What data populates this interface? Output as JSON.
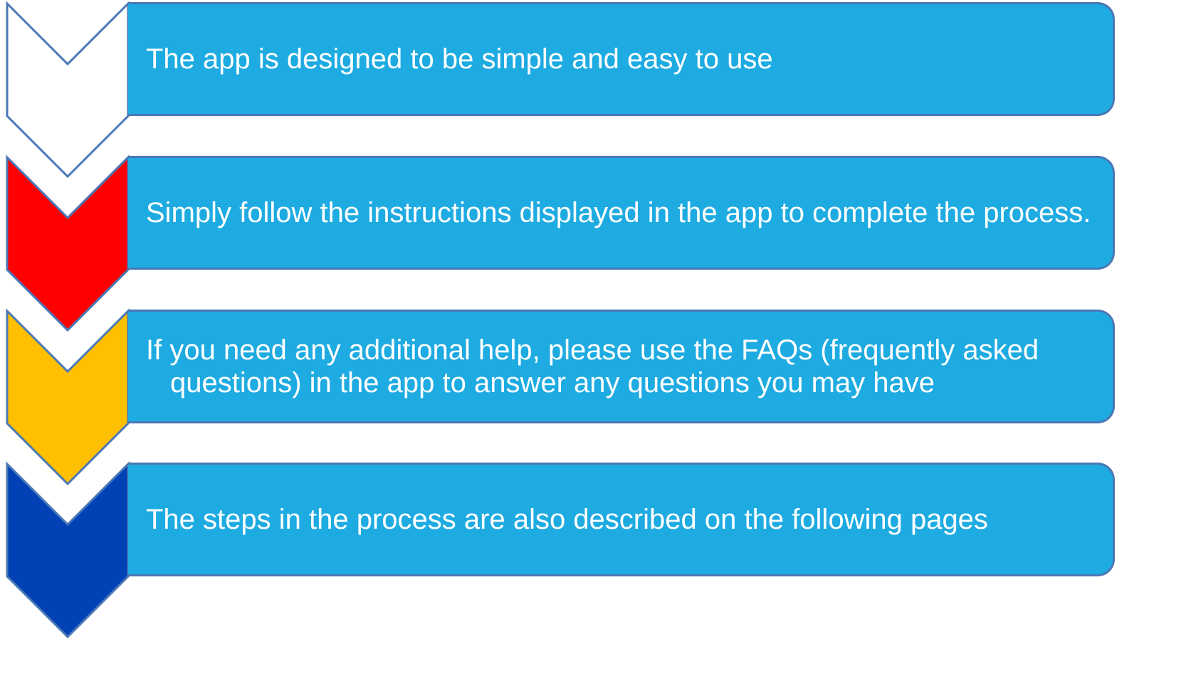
{
  "steps": [
    {
      "text": "The app is designed to be simple and easy to use",
      "color": "#ffffff"
    },
    {
      "text": "Simply follow the instructions displayed in the app to complete the process.",
      "color": "#ff0000"
    },
    {
      "text": "If you need any additional help, please use the FAQs (frequently asked questions) in the app to answer any questions you may have",
      "color": "#ffc000"
    },
    {
      "text": "The steps in the process are also described on the following pages",
      "color": "#0042b5"
    }
  ],
  "colors": {
    "box_fill": "#1eabe2",
    "outline": "#4a78b5"
  }
}
